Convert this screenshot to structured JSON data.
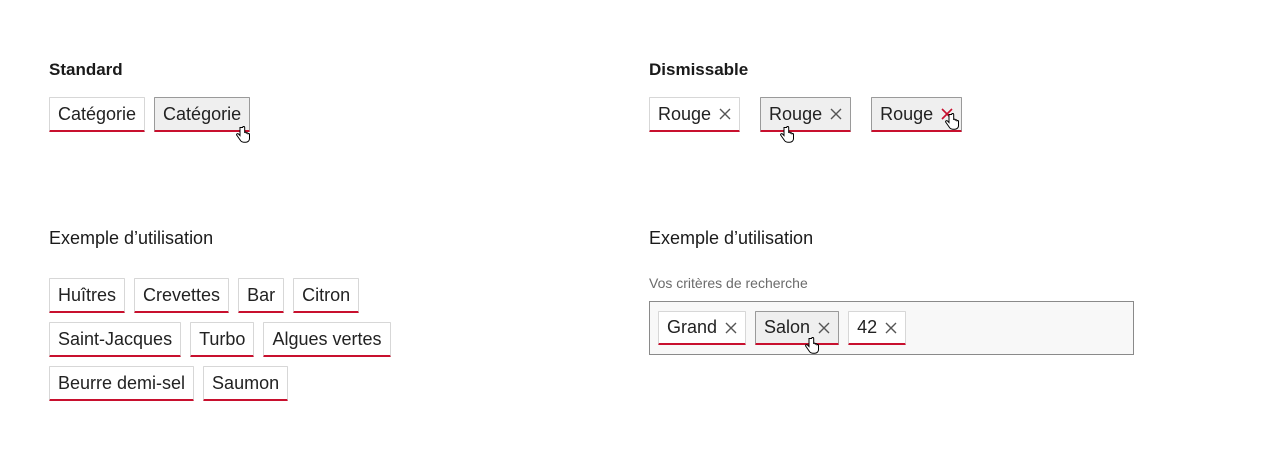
{
  "standard": {
    "heading": "Standard",
    "tags": [
      "Catégorie",
      "Catégorie"
    ]
  },
  "dismissable": {
    "heading": "Dismissable",
    "tags": [
      "Rouge",
      "Rouge",
      "Rouge"
    ]
  },
  "example_left": {
    "heading": "Exemple d’utilisation",
    "rows": [
      [
        "Huîtres",
        "Crevettes",
        "Bar",
        "Citron"
      ],
      [
        "Saint-Jacques",
        "Turbo",
        "Algues vertes"
      ],
      [
        "Beurre demi-sel",
        "Saumon"
      ]
    ]
  },
  "example_right": {
    "heading": "Exemple d’utilisation",
    "field_label": "Vos critères de recherche",
    "tags": [
      "Grand",
      "Salon",
      "42"
    ]
  },
  "icons": {
    "close": "close-icon",
    "cursor": "hand-pointer-icon"
  },
  "colors": {
    "accent": "#c8102e",
    "hover_bg": "#efefef"
  }
}
